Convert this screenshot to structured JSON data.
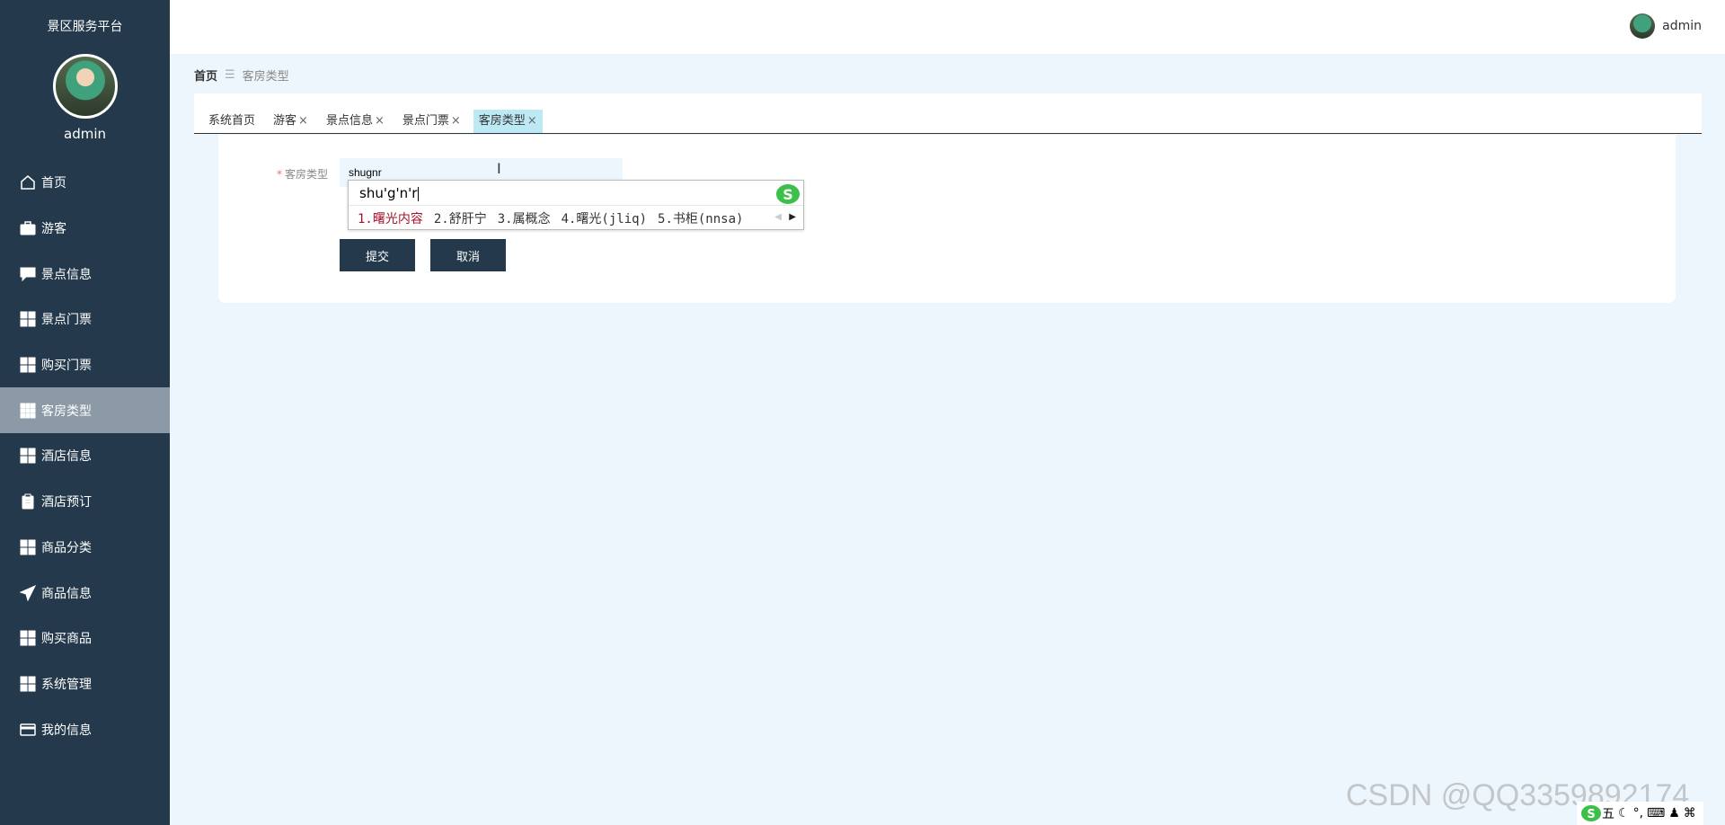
{
  "app": {
    "title": "景区服务平台"
  },
  "user": {
    "name": "admin"
  },
  "sidebar": {
    "items": [
      {
        "label": "首页",
        "icon": "home-icon"
      },
      {
        "label": "游客",
        "icon": "briefcase-icon"
      },
      {
        "label": "景点信息",
        "icon": "chat-icon"
      },
      {
        "label": "景点门票",
        "icon": "grid-icon"
      },
      {
        "label": "购买门票",
        "icon": "grid-icon"
      },
      {
        "label": "客房类型",
        "icon": "grid-9-icon",
        "active": true
      },
      {
        "label": "酒店信息",
        "icon": "grid-icon"
      },
      {
        "label": "酒店预订",
        "icon": "clipboard-icon"
      },
      {
        "label": "商品分类",
        "icon": "grid-icon"
      },
      {
        "label": "商品信息",
        "icon": "send-icon"
      },
      {
        "label": "购买商品",
        "icon": "grid-icon"
      },
      {
        "label": "系统管理",
        "icon": "grid-icon"
      },
      {
        "label": "我的信息",
        "icon": "card-icon"
      }
    ]
  },
  "breadcrumb": {
    "home": "首页",
    "separator": "☰",
    "current": "客房类型"
  },
  "tabs": [
    {
      "label": "系统首页",
      "closable": false
    },
    {
      "label": "游客",
      "closable": true
    },
    {
      "label": "景点信息",
      "closable": true
    },
    {
      "label": "景点门票",
      "closable": true
    },
    {
      "label": "客房类型",
      "closable": true,
      "active": true
    }
  ],
  "form": {
    "required_mark": "*",
    "field_label": "客房类型",
    "field_value": "shugnr",
    "submit_label": "提交",
    "cancel_label": "取消"
  },
  "ime": {
    "composition": "shu'g'n'r",
    "candidates": [
      "1.曙光内容",
      "2.舒肝宁",
      "3.属概念",
      "4.曙光(jliq)",
      "5.书柜(nnsa)"
    ]
  },
  "watermark": "CSDN @QQ3359892174",
  "tray": {
    "mode": "五"
  },
  "colors": {
    "sidebar": "#24394b",
    "active_menu": "#8b9aa6",
    "button": "#24394b",
    "active_tab": "#bde9f5",
    "page_bg": "#edf6fc"
  }
}
